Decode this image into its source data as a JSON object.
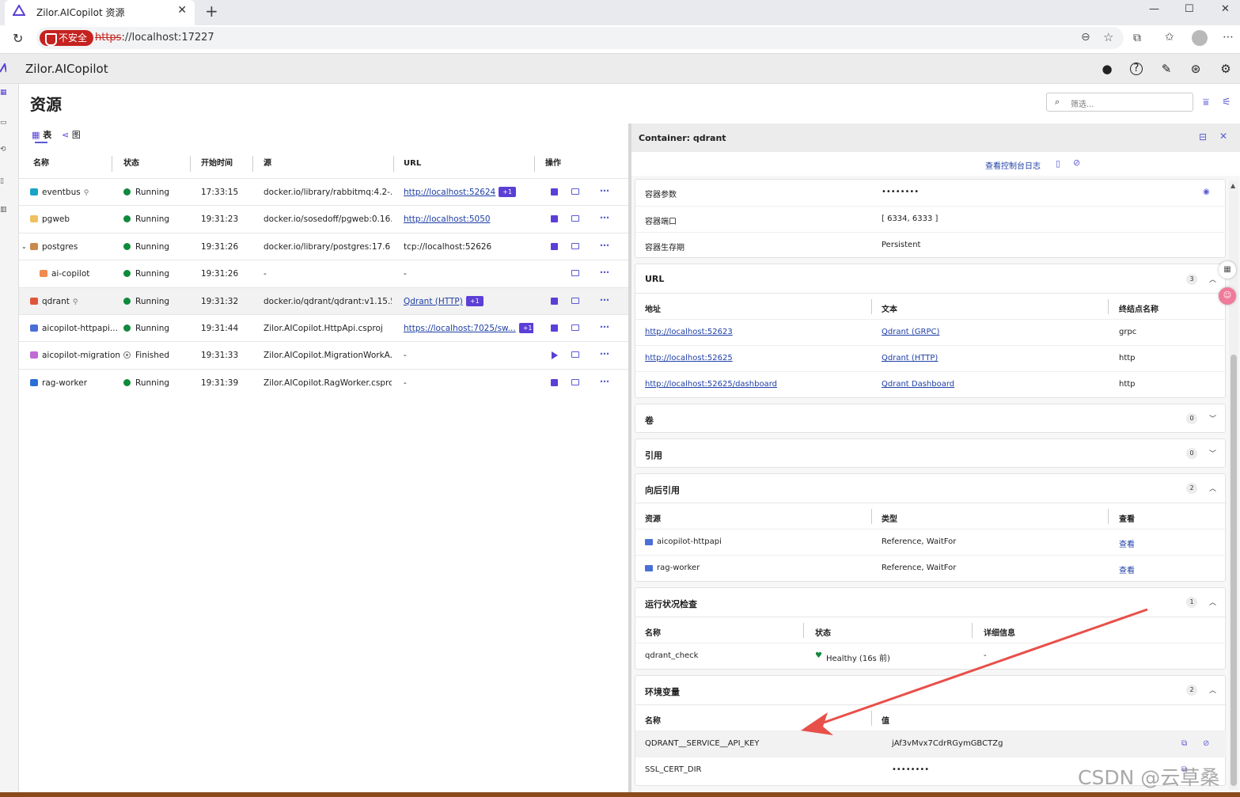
{
  "browser": {
    "tab_title": "Zilor.AICopilot 资源",
    "insecure_label": "不安全",
    "url_scheme": "https",
    "url_rest": "://localhost:17227"
  },
  "app": {
    "name": "Zilor.AICopilot",
    "page_title": "资源",
    "filter_placeholder": "筛选...",
    "view_tabs": [
      "表",
      "图"
    ]
  },
  "resources": {
    "columns": [
      "名称",
      "状态",
      "开始时间",
      "源",
      "URL",
      "操作"
    ],
    "rows": [
      {
        "name": "eventbus",
        "status": "Running",
        "start": "17:33:15",
        "source": "docker.io/library/rabbitmq:4.2-...",
        "url": "http://localhost:52624",
        "extra": "+1",
        "icon_color": "#1aa3c9"
      },
      {
        "name": "pgweb",
        "status": "Running",
        "start": "19:31:23",
        "source": "docker.io/sosedoff/pgweb:0.16....",
        "url": "http://localhost:5050",
        "extra": "",
        "icon_color": "#f0c060"
      },
      {
        "name": "postgres",
        "status": "Running",
        "start": "19:31:26",
        "source": "docker.io/library/postgres:17.6",
        "url": "tcp://localhost:52626",
        "extra": "",
        "icon_color": "#c98a4a"
      },
      {
        "name": "ai-copilot",
        "status": "Running",
        "start": "19:31:26",
        "source": "-",
        "url": "-",
        "extra": "",
        "icon_color": "#f08a50"
      },
      {
        "name": "qdrant",
        "status": "Running",
        "start": "19:31:32",
        "source": "docker.io/qdrant/qdrant:v1.15.5",
        "url": "Qdrant (HTTP)",
        "extra": "+1",
        "icon_color": "#e0553a"
      },
      {
        "name": "aicopilot-httpapi...",
        "status": "Running",
        "start": "19:31:44",
        "source": "Zilor.AICopilot.HttpApi.csproj",
        "url": "https://localhost:7025/sw...",
        "extra": "+1",
        "icon_color": "#4a6fd6"
      },
      {
        "name": "aicopilot-migration",
        "status": "Finished",
        "start": "19:31:33",
        "source": "Zilor.AICopilot.MigrationWorkA...",
        "url": "-",
        "extra": "",
        "icon_color": "#c06ad6"
      },
      {
        "name": "rag-worker",
        "status": "Running",
        "start": "19:31:39",
        "source": "Zilor.AICopilot.RagWorker.csproj",
        "url": "-",
        "extra": "",
        "icon_color": "#2a6fd6"
      }
    ]
  },
  "details": {
    "title": "Container: qdrant",
    "console_log": "查看控制台日志",
    "filter_placeholder": "筛选...",
    "props": [
      {
        "k": "容器参数",
        "v": "••••••••"
      },
      {
        "k": "容器端口",
        "v": "[ 6334, 6333 ]"
      },
      {
        "k": "容器生存期",
        "v": "Persistent"
      }
    ],
    "url_section": {
      "title": "URL",
      "count": "3",
      "cols": [
        "地址",
        "文本",
        "终结点名称"
      ],
      "rows": [
        [
          "http://localhost:52623",
          "Qdrant (GRPC)",
          "grpc"
        ],
        [
          "http://localhost:52625",
          "Qdrant (HTTP)",
          "http"
        ],
        [
          "http://localhost:52625/dashboard",
          "Qdrant Dashboard",
          "http"
        ]
      ]
    },
    "volumes": {
      "title": "卷",
      "count": "0"
    },
    "refs": {
      "title": "引用",
      "count": "0"
    },
    "backrefs": {
      "title": "向后引用",
      "count": "2",
      "cols": [
        "资源",
        "类型",
        "查看"
      ],
      "rows": [
        [
          "aicopilot-httpapi",
          "Reference, WaitFor",
          "查看"
        ],
        [
          "rag-worker",
          "Reference, WaitFor",
          "查看"
        ]
      ]
    },
    "health": {
      "title": "运行状况检查",
      "count": "1",
      "cols": [
        "名称",
        "状态",
        "详细信息"
      ],
      "rows": [
        [
          "qdrant_check",
          "Healthy (16s 前)",
          "-"
        ]
      ]
    },
    "env": {
      "title": "环境变量",
      "count": "2",
      "cols": [
        "名称",
        "值"
      ],
      "rows": [
        [
          "QDRANT__SERVICE__API_KEY",
          "jAf3vMvx7CdrRGymGBCTZg"
        ],
        [
          "SSL_CERT_DIR",
          "••••••••"
        ]
      ]
    }
  },
  "watermark": "CSDN @云草桑",
  "colors": {
    "accent": "#5b3fd6",
    "link": "#1f3fa6",
    "running": "#0f8a3c",
    "arrow": "#e8504a"
  }
}
